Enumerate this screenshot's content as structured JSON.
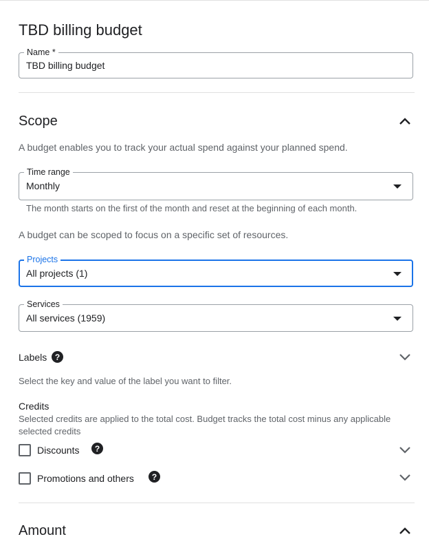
{
  "page": {
    "title": "TBD billing budget"
  },
  "name_field": {
    "label": "Name *",
    "value": "TBD billing budget"
  },
  "scope": {
    "title": "Scope",
    "description": "A budget enables you to track your actual spend against your planned spend.",
    "time_range": {
      "label": "Time range",
      "value": "Monthly",
      "hint": "The month starts on the first of the month and reset at the beginning of each month."
    },
    "resources_note": "A budget can be scoped to focus on a specific set of resources.",
    "projects": {
      "label": "Projects",
      "value": "All projects (1)"
    },
    "services": {
      "label": "Services",
      "value": "All services (1959)"
    },
    "labels": {
      "title": "Labels",
      "description": "Select the key and value of the label you want to filter."
    },
    "credits": {
      "title": "Credits",
      "description": "Selected credits are applied to the total cost. Budget tracks the total cost minus any applicable selected credits",
      "discounts_label": "Discounts",
      "promotions_label": "Promotions and others"
    }
  },
  "amount": {
    "title": "Amount"
  },
  "icons": {
    "expand_less": "chevron-up-icon",
    "expand_more": "chevron-down-icon",
    "help": "help-circle-icon",
    "dropdown": "arrow-drop-down-icon"
  },
  "colors": {
    "accent": "#1a73e8",
    "text": "#202124",
    "secondary_text": "#5f6368",
    "divider": "#e0e0e0"
  }
}
